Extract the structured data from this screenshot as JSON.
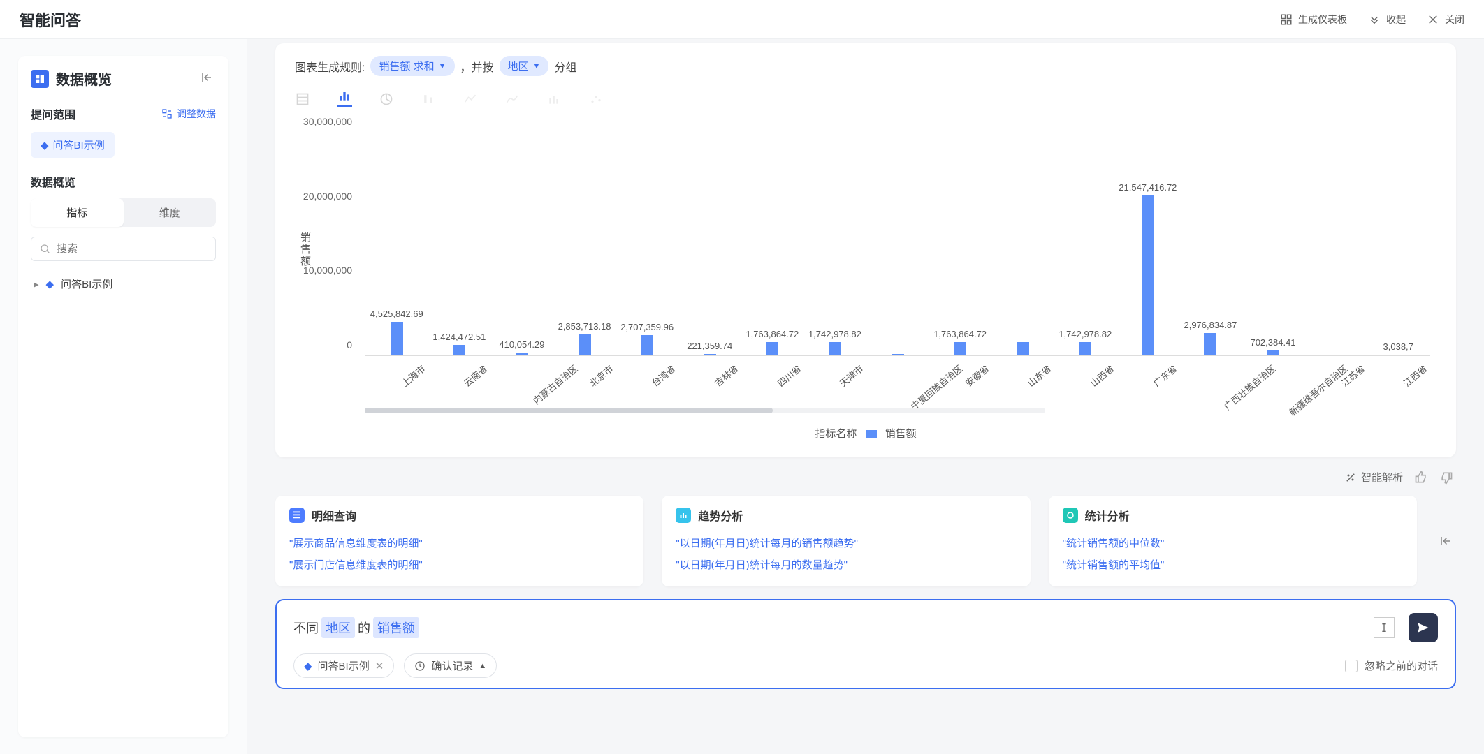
{
  "header": {
    "title": "智能问答",
    "generate_dashboard": "生成仪表板",
    "collapse": "收起",
    "close": "关闭"
  },
  "sidebar": {
    "title": "数据概览",
    "scope": {
      "label": "提问范围",
      "adjust": "调整数据",
      "chip": "问答BI示例"
    },
    "overview_label": "数据概览",
    "tabs": {
      "metric": "指标",
      "dimension": "维度"
    },
    "search_placeholder": "搜索",
    "tree_item": "问答BI示例"
  },
  "chart_rule": {
    "prefix": "图表生成规则:",
    "metric": "销售额 求和",
    "mid1": "，并按",
    "dimension": "地区",
    "suffix": "分组"
  },
  "chart_data": {
    "type": "bar",
    "title": "",
    "xlabel": "",
    "ylabel": "销售额",
    "ylim": [
      0,
      30000000
    ],
    "y_ticks": [
      "0",
      "10,000,000",
      "20,000,000",
      "30,000,000"
    ],
    "legend_label": "指标名称",
    "series_name": "销售额",
    "categories": [
      "上海市",
      "云南省",
      "内蒙古自治区",
      "北京市",
      "台湾省",
      "吉林省",
      "四川省",
      "天津市",
      "宁夏回族自治区",
      "安徽省",
      "山东省",
      "山西省",
      "广东省",
      "广西壮族自治区",
      "新疆维吾尔自治区",
      "江苏省",
      "江西省"
    ],
    "values": [
      4525842.69,
      1424472.51,
      410054.29,
      2853713.18,
      2707359.96,
      221359.74,
      1763864.72,
      1742978.82,
      200000,
      1763864.72,
      1742978.82,
      1742978.82,
      21547416.72,
      2976834.87,
      702384.41,
      3038.7,
      3038.7
    ],
    "value_labels": [
      "4,525,842.69",
      "1,424,472.51",
      "410,054.29",
      "2,853,713.18",
      "2,707,359.96",
      "221,359.74",
      "1,763,864.72",
      "1,742,978.82",
      "",
      "1,763,864.72",
      "",
      "1,742,978.82",
      "21,547,416.72",
      "2,976,834.87",
      "702,384.41",
      "",
      "3,038,7"
    ]
  },
  "smart_analysis": "智能解析",
  "suggestions": {
    "detail": {
      "title": "明细查询",
      "items": [
        "\"展示商品信息维度表的明细\"",
        "\"展示门店信息维度表的明细\""
      ]
    },
    "trend": {
      "title": "趋势分析",
      "items": [
        "\"以日期(年月日)统计每月的销售额趋势\"",
        "\"以日期(年月日)统计每月的数量趋势\""
      ]
    },
    "stats": {
      "title": "统计分析",
      "items": [
        "\"统计销售额的中位数\"",
        "\"统计销售额的平均值\""
      ]
    }
  },
  "input": {
    "prefix": "不同 ",
    "token1": "地区",
    "mid": " 的 ",
    "token2": "销售额",
    "chip_scope": "问答BI示例",
    "chip_history": "确认记录",
    "ignore_prev": "忽略之前的对话"
  }
}
